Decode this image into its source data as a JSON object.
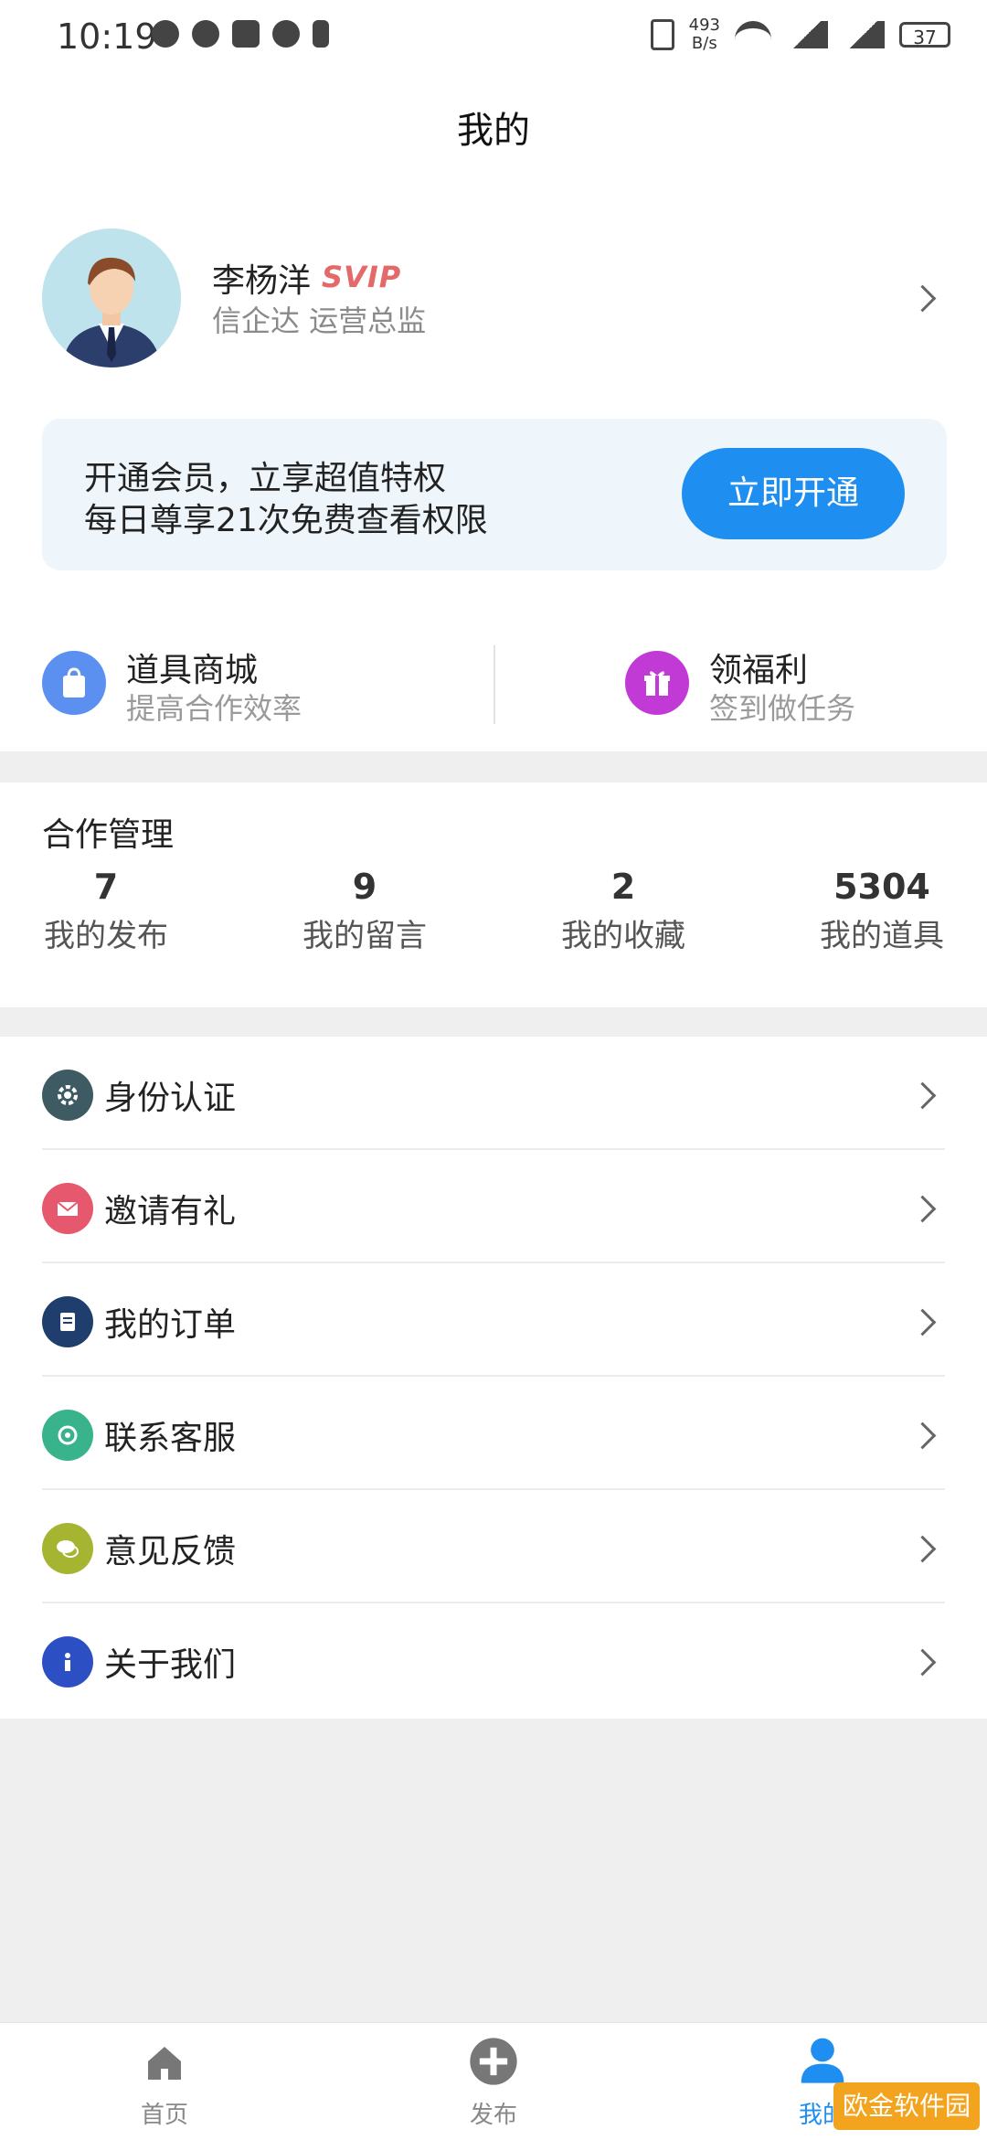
{
  "status_bar": {
    "time": "10:19",
    "net_speed": "493\nB/s",
    "battery": "37",
    "icons": [
      "message-icon",
      "data-saver-icon",
      "nfc-icon",
      "alarm-icon",
      "bluetooth-icon",
      "vibrate-icon",
      "wifi-icon",
      "signal-4g-icon",
      "signal-4g-icon",
      "battery-icon"
    ]
  },
  "header": {
    "title": "我的"
  },
  "profile": {
    "name": "李杨洋",
    "badge": "SVIP",
    "subtitle": "信企达 运营总监"
  },
  "vip_banner": {
    "line1": "开通会员，立享超值特权",
    "line2": "每日尊享21次免费查看权限",
    "button": "立即开通"
  },
  "quick_actions": [
    {
      "title": "道具商城",
      "subtitle": "提高合作效率",
      "icon": "shopping-bag-icon",
      "color": "#5b8ff0"
    },
    {
      "title": "领福利",
      "subtitle": "签到做任务",
      "icon": "gift-icon",
      "color": "#c23ad6"
    }
  ],
  "cooperation": {
    "title": "合作管理",
    "stats": [
      {
        "value": "7",
        "label": "我的发布"
      },
      {
        "value": "9",
        "label": "我的留言"
      },
      {
        "value": "2",
        "label": "我的收藏"
      },
      {
        "value": "5304",
        "label": "我的道具"
      }
    ]
  },
  "menu": [
    {
      "label": "身份认证",
      "icon": "identity-gear-icon",
      "color": "#3e5a63"
    },
    {
      "label": "邀请有礼",
      "icon": "envelope-icon",
      "color": "#e5586d"
    },
    {
      "label": "我的订单",
      "icon": "order-document-icon",
      "color": "#1f3e6e"
    },
    {
      "label": "联系客服",
      "icon": "customer-service-icon",
      "color": "#39b38c"
    },
    {
      "label": "意见反馈",
      "icon": "feedback-chat-icon",
      "color": "#a5b531"
    },
    {
      "label": "关于我们",
      "icon": "info-icon",
      "color": "#2c4fc4"
    }
  ],
  "bottom_nav": [
    {
      "label": "首页",
      "icon": "home-icon"
    },
    {
      "label": "发布",
      "icon": "plus-circle-icon"
    },
    {
      "label": "我的",
      "icon": "user-icon",
      "active": true
    }
  ],
  "watermark": "欧金软件园"
}
